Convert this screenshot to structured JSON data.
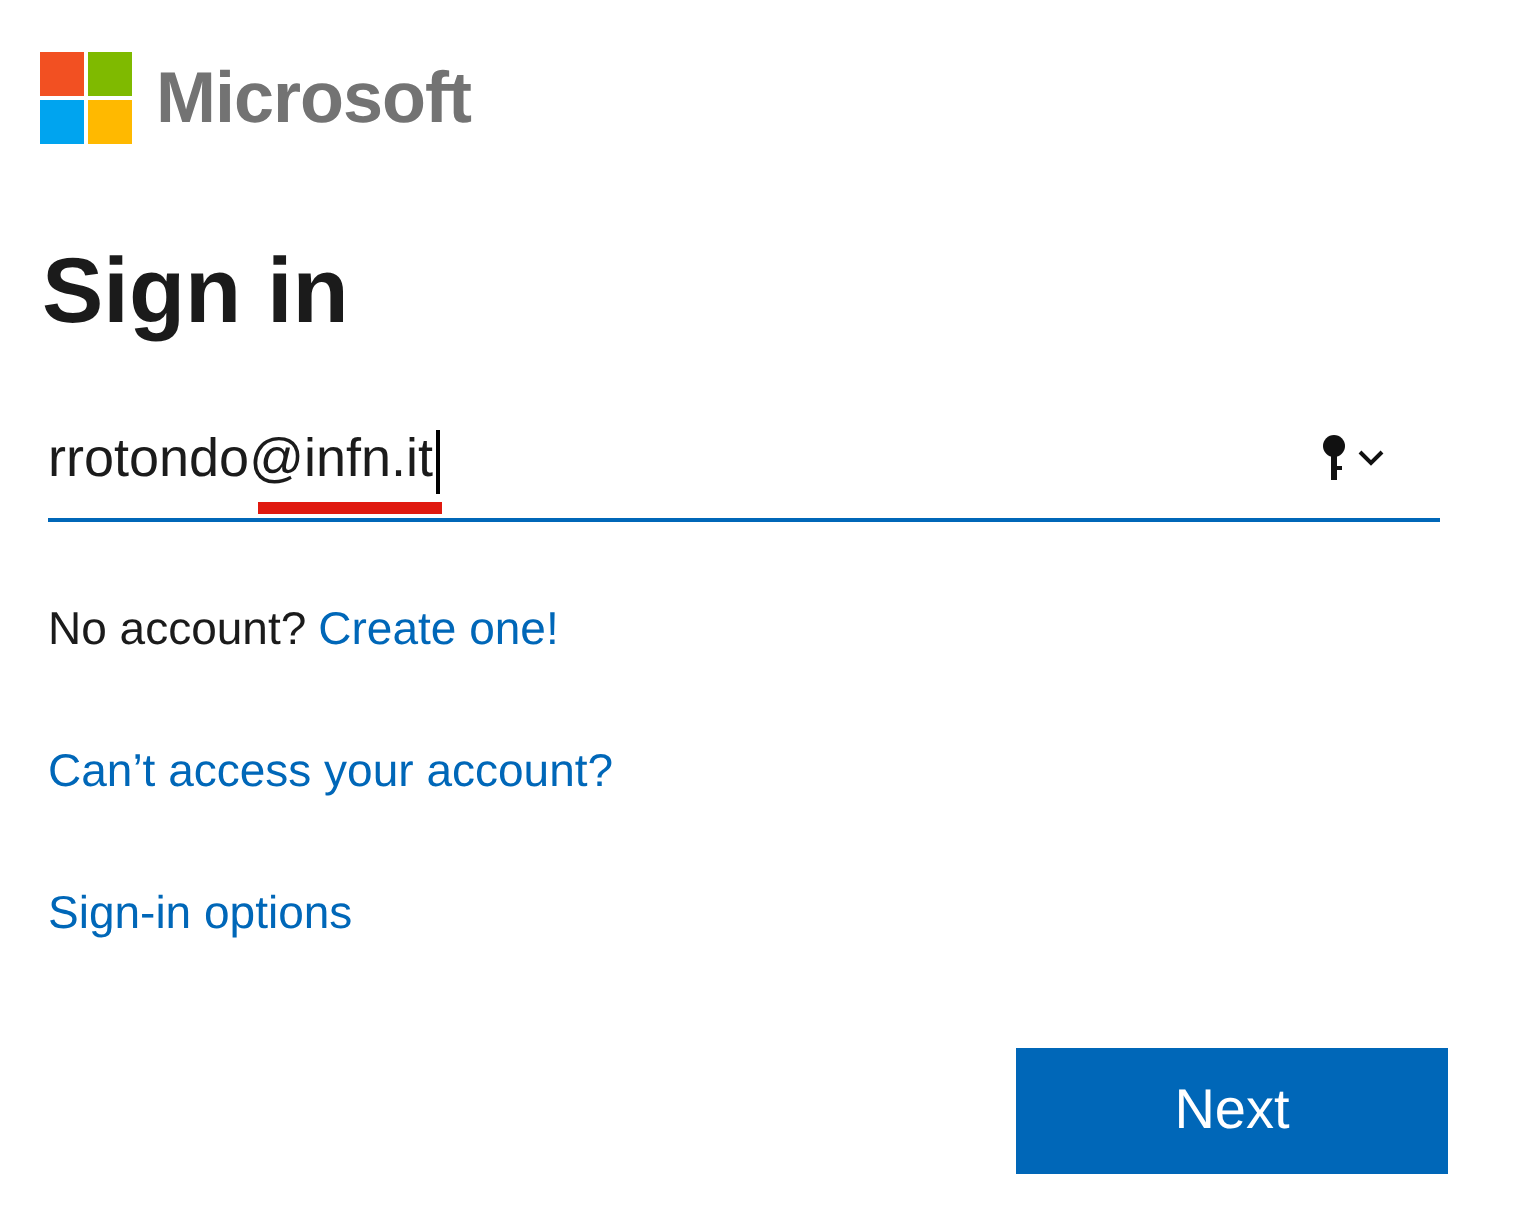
{
  "logo": {
    "wordmark": "Microsoft"
  },
  "title": "Sign in",
  "email_field": {
    "value": "rrotondo@infn.it",
    "focused": true
  },
  "signup": {
    "prompt": "No account?",
    "link": "Create one!"
  },
  "links": [
    "Can’t access your account?",
    "Sign-in options"
  ],
  "buttons": [
    "Next"
  ]
}
